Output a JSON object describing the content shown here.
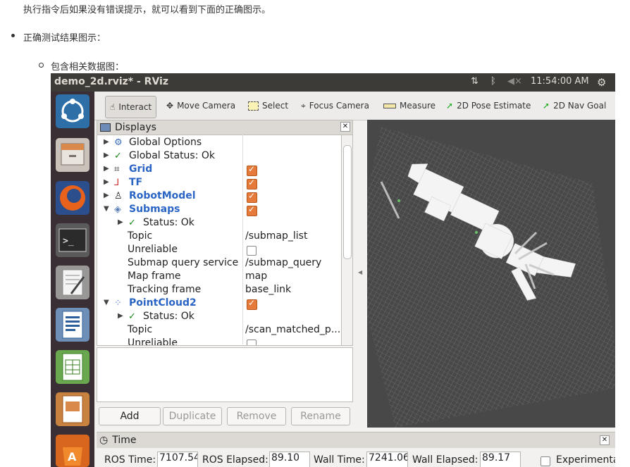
{
  "doc": {
    "intro_line": "执行指令后如果没有错误提示，就可以看到下面的正确图示。",
    "bullet1": "正确测试结果图示：",
    "bullet2": "包含相关数据图："
  },
  "window": {
    "title": "demo_2d.rviz* - RViz",
    "clock": "11:54:00 AM"
  },
  "toolbar": {
    "interact": "Interact",
    "move_camera": "Move Camera",
    "select": "Select",
    "focus_camera": "Focus Camera",
    "measure": "Measure",
    "pose_estimate": "2D Pose Estimate",
    "nav_goal": "2D Nav Goal"
  },
  "displays": {
    "title": "Displays",
    "rows": [
      {
        "label": "Global Options",
        "value": ""
      },
      {
        "label": "Global Status: Ok",
        "value": ""
      },
      {
        "label": "Grid",
        "value": ""
      },
      {
        "label": "TF",
        "value": ""
      },
      {
        "label": "RobotModel",
        "value": ""
      },
      {
        "label": "Submaps",
        "value": ""
      },
      {
        "label": "Status: Ok",
        "value": ""
      },
      {
        "label": "Topic",
        "value": "/submap_list"
      },
      {
        "label": "Unreliable",
        "value": ""
      },
      {
        "label": "Submap query service",
        "value": "/submap_query"
      },
      {
        "label": "Map frame",
        "value": "map"
      },
      {
        "label": "Tracking frame",
        "value": "base_link"
      },
      {
        "label": "PointCloud2",
        "value": ""
      },
      {
        "label": "Status: Ok",
        "value": ""
      },
      {
        "label": "Topic",
        "value": "/scan_matched_p..."
      },
      {
        "label": "Unreliable",
        "value": ""
      }
    ],
    "buttons": {
      "add": "Add",
      "duplicate": "Duplicate",
      "remove": "Remove",
      "rename": "Rename"
    }
  },
  "time": {
    "title": "Time",
    "ros_time_label": "ROS Time:",
    "ros_time": "7107.54",
    "ros_elapsed_label": "ROS Elapsed:",
    "ros_elapsed": "89.10",
    "wall_time_label": "Wall Time:",
    "wall_time": "7241.06",
    "wall_elapsed_label": "Wall Elapsed:",
    "wall_elapsed": "89.17",
    "experimental": "Experimenta"
  },
  "colors": {
    "accent_orange": "#e57a3a",
    "launcher": "#3a2f35",
    "titlebar": "#3c3b37",
    "view_bg": "#484848"
  }
}
